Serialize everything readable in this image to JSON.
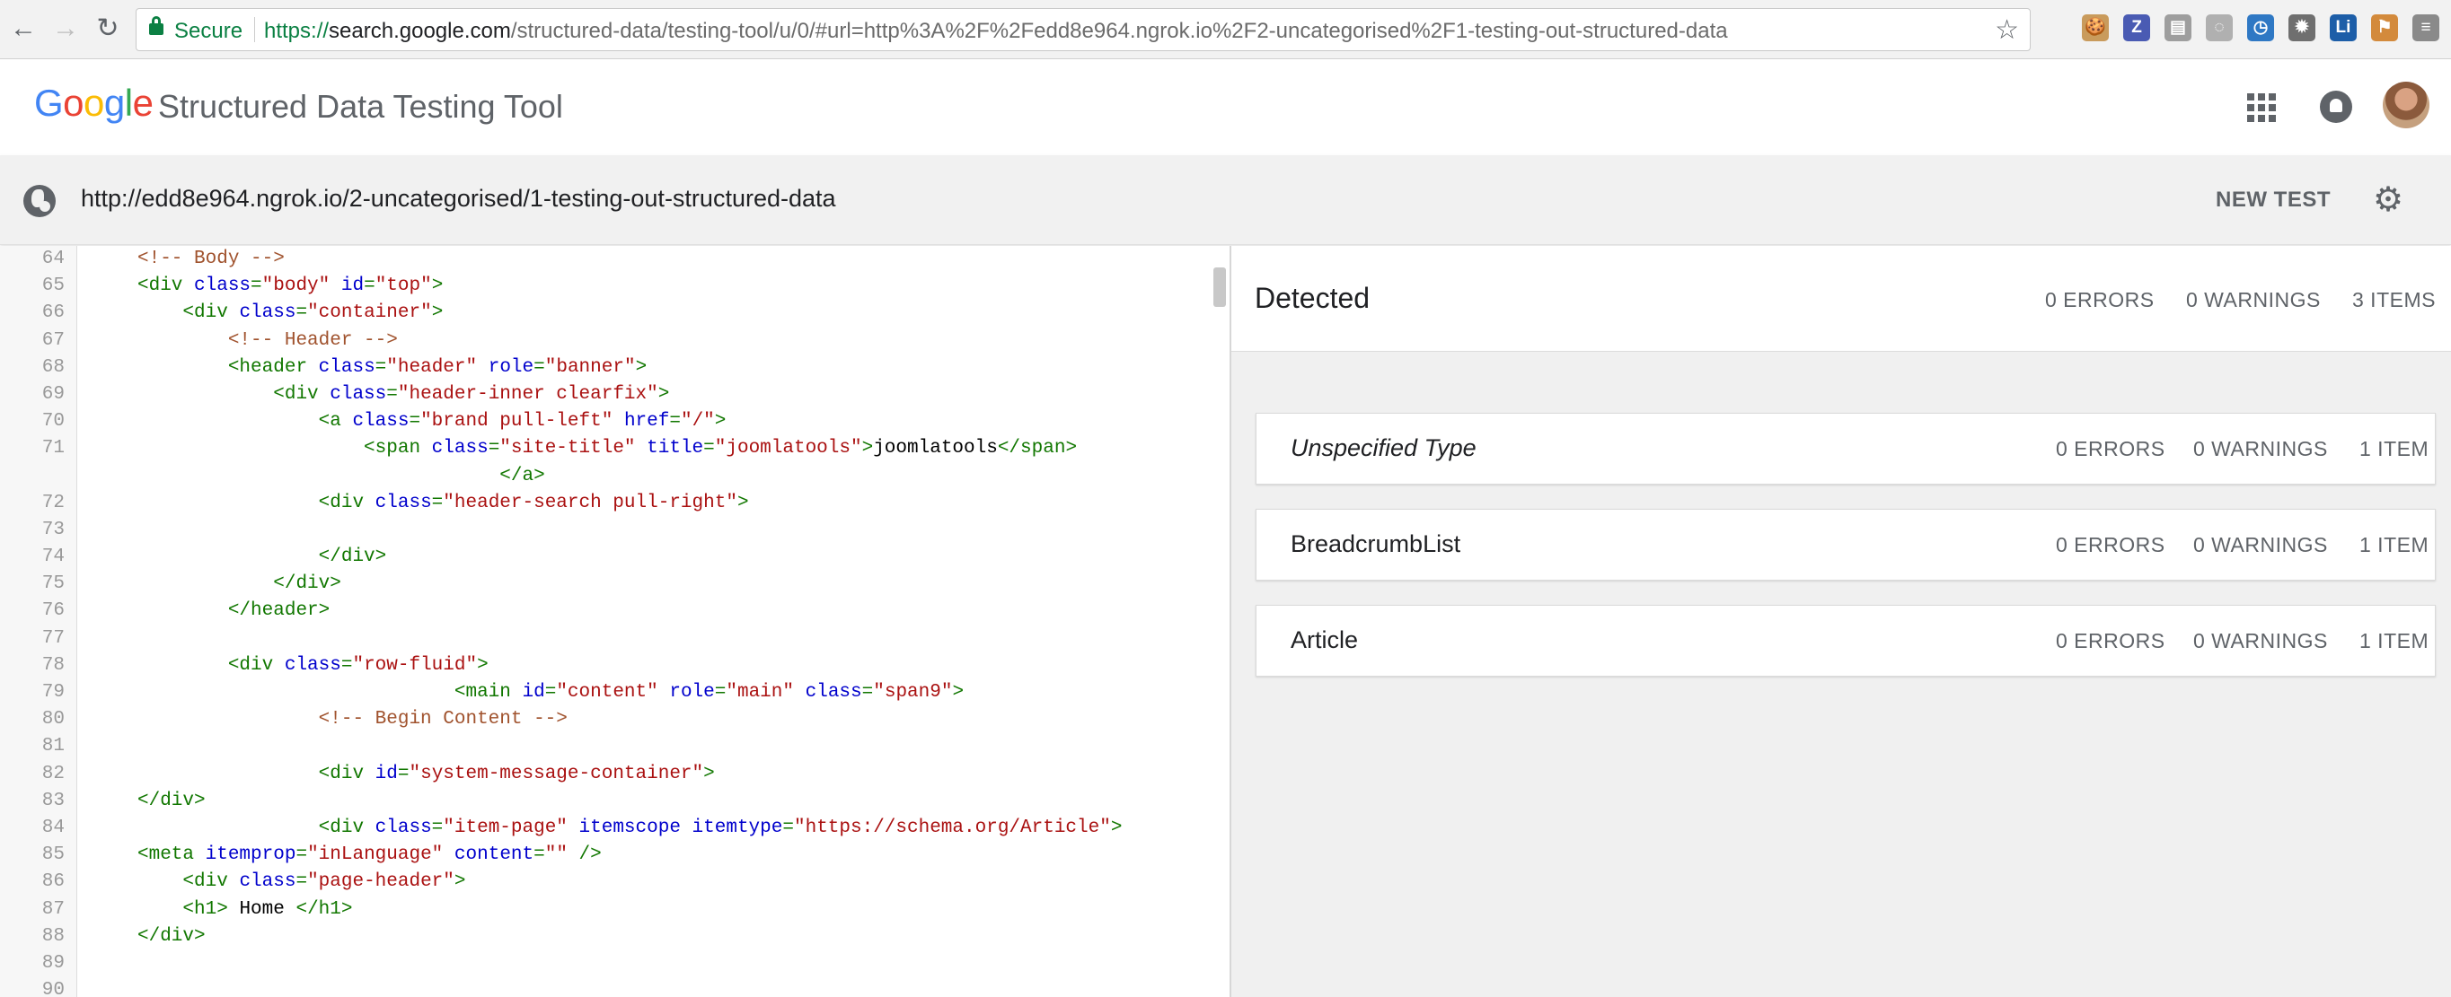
{
  "browser": {
    "secure_label": "Secure",
    "url_scheme": "https://",
    "url_host": "search.google.com",
    "url_path": "/structured-data/testing-tool/u/0/#url=http%3A%2F%2Fedd8e964.ngrok.io%2F2-uncategorised%2F1-testing-out-structured-data",
    "extensions": [
      {
        "name": "cookie-extension-icon",
        "glyph": "🍪",
        "color": "#c99b5c"
      },
      {
        "name": "zotero-extension-icon",
        "glyph": "Z",
        "color": "#4a5bb3"
      },
      {
        "name": "page-extension-icon",
        "glyph": "▤",
        "color": "#9e9e9e"
      },
      {
        "name": "circle-extension-icon",
        "glyph": "◌",
        "color": "#b0b0b0"
      },
      {
        "name": "clock-extension-icon",
        "glyph": "◷",
        "color": "#2f78c4"
      },
      {
        "name": "settings-extension-icon",
        "glyph": "✹",
        "color": "#6f6f6f"
      },
      {
        "name": "li-extension-icon",
        "glyph": "Li",
        "color": "#1d5ea8"
      },
      {
        "name": "flag-extension-icon",
        "glyph": "⚑",
        "color": "#d38a3c"
      },
      {
        "name": "menu-extension-icon",
        "glyph": "≡",
        "color": "#8a8a8a"
      }
    ]
  },
  "header": {
    "logo_letters": [
      {
        "char": "G",
        "color": "#4285F4"
      },
      {
        "char": "o",
        "color": "#EA4335"
      },
      {
        "char": "o",
        "color": "#FBBC05"
      },
      {
        "char": "g",
        "color": "#4285F4"
      },
      {
        "char": "l",
        "color": "#34A853"
      },
      {
        "char": "e",
        "color": "#EA4335"
      }
    ],
    "title": "Structured Data Testing Tool"
  },
  "url_bar": {
    "tested_url": "http://edd8e964.ngrok.io/2-uncategorised/1-testing-out-structured-data",
    "new_test_label": "NEW TEST"
  },
  "code": {
    "lines": [
      {
        "n": "64",
        "tokens": [
          [
            "c-comment",
            "<!-- Body -->"
          ]
        ]
      },
      {
        "n": "65",
        "tokens": [
          [
            "c-tag",
            "<div "
          ],
          [
            "c-attr",
            "class"
          ],
          [
            "c-tag",
            "="
          ],
          [
            "c-str",
            "\"body\""
          ],
          [
            "c-tag",
            " "
          ],
          [
            "c-attr",
            "id"
          ],
          [
            "c-tag",
            "="
          ],
          [
            "c-str",
            "\"top\""
          ],
          [
            "c-tag",
            ">"
          ]
        ]
      },
      {
        "n": "66",
        "tokens": [
          [
            "c-text",
            "    "
          ],
          [
            "c-tag",
            "<div "
          ],
          [
            "c-attr",
            "class"
          ],
          [
            "c-tag",
            "="
          ],
          [
            "c-str",
            "\"container\""
          ],
          [
            "c-tag",
            ">"
          ]
        ]
      },
      {
        "n": "67",
        "tokens": [
          [
            "c-text",
            "        "
          ],
          [
            "c-comment",
            "<!-- Header -->"
          ]
        ]
      },
      {
        "n": "68",
        "tokens": [
          [
            "c-text",
            "        "
          ],
          [
            "c-tag",
            "<header "
          ],
          [
            "c-attr",
            "class"
          ],
          [
            "c-tag",
            "="
          ],
          [
            "c-str",
            "\"header\""
          ],
          [
            "c-tag",
            " "
          ],
          [
            "c-attr",
            "role"
          ],
          [
            "c-tag",
            "="
          ],
          [
            "c-str",
            "\"banner\""
          ],
          [
            "c-tag",
            ">"
          ]
        ]
      },
      {
        "n": "69",
        "tokens": [
          [
            "c-text",
            "            "
          ],
          [
            "c-tag",
            "<div "
          ],
          [
            "c-attr",
            "class"
          ],
          [
            "c-tag",
            "="
          ],
          [
            "c-str",
            "\"header-inner clearfix\""
          ],
          [
            "c-tag",
            ">"
          ]
        ]
      },
      {
        "n": "70",
        "tokens": [
          [
            "c-text",
            "                "
          ],
          [
            "c-tag",
            "<a "
          ],
          [
            "c-attr",
            "class"
          ],
          [
            "c-tag",
            "="
          ],
          [
            "c-str",
            "\"brand pull-left\""
          ],
          [
            "c-tag",
            " "
          ],
          [
            "c-attr",
            "href"
          ],
          [
            "c-tag",
            "="
          ],
          [
            "c-str",
            "\"/\""
          ],
          [
            "c-tag",
            ">"
          ]
        ]
      },
      {
        "n": "71",
        "tokens": [
          [
            "c-text",
            "                    "
          ],
          [
            "c-tag",
            "<span "
          ],
          [
            "c-attr",
            "class"
          ],
          [
            "c-tag",
            "="
          ],
          [
            "c-str",
            "\"site-title\""
          ],
          [
            "c-tag",
            " "
          ],
          [
            "c-attr",
            "title"
          ],
          [
            "c-tag",
            "="
          ],
          [
            "c-str",
            "\"joomlatools\""
          ],
          [
            "c-tag",
            ">"
          ],
          [
            "c-text",
            "joomlatools"
          ],
          [
            "c-tag",
            "</span>"
          ]
        ]
      },
      {
        "n": "",
        "tokens": [
          [
            "c-text",
            "                                "
          ],
          [
            "c-tag",
            "</a>"
          ]
        ]
      },
      {
        "n": "72",
        "tokens": [
          [
            "c-text",
            "                "
          ],
          [
            "c-tag",
            "<div "
          ],
          [
            "c-attr",
            "class"
          ],
          [
            "c-tag",
            "="
          ],
          [
            "c-str",
            "\"header-search pull-right\""
          ],
          [
            "c-tag",
            ">"
          ]
        ]
      },
      {
        "n": "73",
        "tokens": []
      },
      {
        "n": "74",
        "tokens": [
          [
            "c-text",
            "                "
          ],
          [
            "c-tag",
            "</div>"
          ]
        ]
      },
      {
        "n": "75",
        "tokens": [
          [
            "c-text",
            "            "
          ],
          [
            "c-tag",
            "</div>"
          ]
        ]
      },
      {
        "n": "76",
        "tokens": [
          [
            "c-text",
            "        "
          ],
          [
            "c-tag",
            "</header>"
          ]
        ]
      },
      {
        "n": "77",
        "tokens": []
      },
      {
        "n": "78",
        "tokens": [
          [
            "c-text",
            "        "
          ],
          [
            "c-tag",
            "<div "
          ],
          [
            "c-attr",
            "class"
          ],
          [
            "c-tag",
            "="
          ],
          [
            "c-str",
            "\"row-fluid\""
          ],
          [
            "c-tag",
            ">"
          ]
        ]
      },
      {
        "n": "79",
        "tokens": [
          [
            "c-text",
            "                            "
          ],
          [
            "c-tag",
            "<main "
          ],
          [
            "c-attr",
            "id"
          ],
          [
            "c-tag",
            "="
          ],
          [
            "c-str",
            "\"content\""
          ],
          [
            "c-tag",
            " "
          ],
          [
            "c-attr",
            "role"
          ],
          [
            "c-tag",
            "="
          ],
          [
            "c-str",
            "\"main\""
          ],
          [
            "c-tag",
            " "
          ],
          [
            "c-attr",
            "class"
          ],
          [
            "c-tag",
            "="
          ],
          [
            "c-str",
            "\"span9\""
          ],
          [
            "c-tag",
            ">"
          ]
        ]
      },
      {
        "n": "80",
        "tokens": [
          [
            "c-text",
            "                "
          ],
          [
            "c-comment",
            "<!-- Begin Content -->"
          ]
        ]
      },
      {
        "n": "81",
        "tokens": []
      },
      {
        "n": "82",
        "tokens": [
          [
            "c-text",
            "                "
          ],
          [
            "c-tag",
            "<div "
          ],
          [
            "c-attr",
            "id"
          ],
          [
            "c-tag",
            "="
          ],
          [
            "c-str",
            "\"system-message-container\""
          ],
          [
            "c-tag",
            ">"
          ]
        ]
      },
      {
        "n": "83",
        "tokens": [
          [
            "c-tag",
            "</div>"
          ]
        ]
      },
      {
        "n": "84",
        "tokens": [
          [
            "c-text",
            "                "
          ],
          [
            "c-tag",
            "<div "
          ],
          [
            "c-attr",
            "class"
          ],
          [
            "c-tag",
            "="
          ],
          [
            "c-str",
            "\"item-page\""
          ],
          [
            "c-tag",
            " "
          ],
          [
            "c-attr",
            "itemscope"
          ],
          [
            "c-tag",
            " "
          ],
          [
            "c-attr",
            "itemtype"
          ],
          [
            "c-tag",
            "="
          ],
          [
            "c-str",
            "\"https://schema.org/Article\""
          ],
          [
            "c-tag",
            ">"
          ]
        ]
      },
      {
        "n": "85",
        "tokens": [
          [
            "c-tag",
            "<meta "
          ],
          [
            "c-attr",
            "itemprop"
          ],
          [
            "c-tag",
            "="
          ],
          [
            "c-str",
            "\"inLanguage\""
          ],
          [
            "c-tag",
            " "
          ],
          [
            "c-attr",
            "content"
          ],
          [
            "c-tag",
            "="
          ],
          [
            "c-str",
            "\"\""
          ],
          [
            "c-tag",
            " />"
          ]
        ]
      },
      {
        "n": "86",
        "tokens": [
          [
            "c-text",
            "    "
          ],
          [
            "c-tag",
            "<div "
          ],
          [
            "c-attr",
            "class"
          ],
          [
            "c-tag",
            "="
          ],
          [
            "c-str",
            "\"page-header\""
          ],
          [
            "c-tag",
            ">"
          ]
        ]
      },
      {
        "n": "87",
        "tokens": [
          [
            "c-text",
            "    "
          ],
          [
            "c-tag",
            "<h1>"
          ],
          [
            "c-text",
            " Home "
          ],
          [
            "c-tag",
            "</h1>"
          ]
        ]
      },
      {
        "n": "88",
        "tokens": [
          [
            "c-tag",
            "</div>"
          ]
        ]
      },
      {
        "n": "89",
        "tokens": []
      },
      {
        "n": "90",
        "tokens": []
      }
    ]
  },
  "results": {
    "title": "Detected",
    "errors": "0 ERRORS",
    "warnings": "0 WARNINGS",
    "items": "3 ITEMS",
    "cards": [
      {
        "title": "Unspecified Type",
        "italic": true,
        "errors": "0 ERRORS",
        "warnings": "0 WARNINGS",
        "items": "1 ITEM"
      },
      {
        "title": "BreadcrumbList",
        "italic": false,
        "errors": "0 ERRORS",
        "warnings": "0 WARNINGS",
        "items": "1 ITEM"
      },
      {
        "title": "Article",
        "italic": false,
        "errors": "0 ERRORS",
        "warnings": "0 WARNINGS",
        "items": "1 ITEM"
      }
    ]
  }
}
